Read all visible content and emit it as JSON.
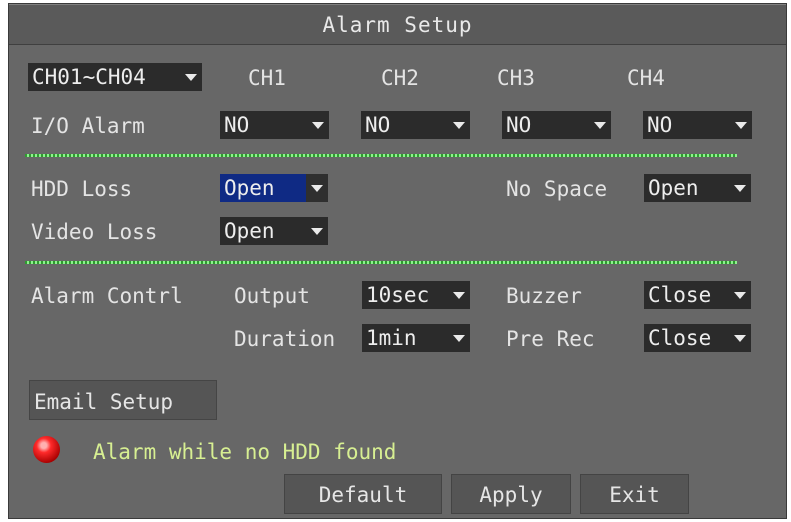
{
  "title": "Alarm Setup",
  "channel_group": {
    "value": "CH01~CH04"
  },
  "channels": [
    "CH1",
    "CH2",
    "CH3",
    "CH4"
  ],
  "io_alarm": {
    "label": "I/O Alarm",
    "values": [
      "NO",
      "NO",
      "NO",
      "NO"
    ]
  },
  "hdd_loss": {
    "label": "HDD Loss",
    "value": "Open"
  },
  "no_space": {
    "label": "No Space",
    "value": "Open"
  },
  "video_loss": {
    "label": "Video Loss",
    "value": "Open"
  },
  "alarm_control": {
    "label": "Alarm Contrl",
    "output_label": "Output",
    "output_value": "10sec",
    "buzzer_label": "Buzzer",
    "buzzer_value": "Close",
    "duration_label": "Duration",
    "duration_value": "1min",
    "prerec_label": "Pre Rec",
    "prerec_value": "Close"
  },
  "email_setup_label": "Email Setup",
  "hdd_alarm_text": "Alarm while no HDD found",
  "buttons": {
    "default": "Default",
    "apply": "Apply",
    "exit": "Exit"
  },
  "colors": {
    "panel": "#676767",
    "dropdown": "#2b2b2b",
    "highlight": "#0f2a84",
    "divider": "#5ad35a",
    "alarm_text": "#d7ef92",
    "led": "#e01818"
  }
}
